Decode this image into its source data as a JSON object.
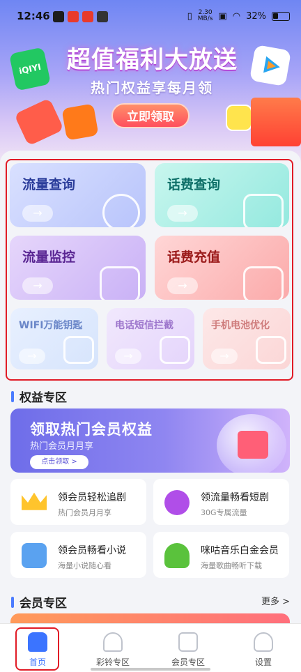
{
  "status_bar": {
    "time": "12:46",
    "net_speed": "2.30",
    "net_unit": "MB/s",
    "battery": "32%"
  },
  "banner": {
    "title": "超值福利大放送",
    "subtitle": "热门权益享每月领",
    "cta": "立即领取",
    "iqiyi_logo_text": "iQIYI"
  },
  "tools": [
    {
      "label": "流量查询",
      "arrow": "→",
      "icon": "chart-icon"
    },
    {
      "label": "话费查询",
      "arrow": "→",
      "icon": "bill-search-icon"
    },
    {
      "label": "流量监控",
      "arrow": "→",
      "icon": "transfer-icon"
    },
    {
      "label": "话费充值",
      "arrow": "→",
      "icon": "yen-phone-icon"
    },
    {
      "label": "WIFI万能钥匙",
      "arrow": "→",
      "icon": "wifi-icon"
    },
    {
      "label": "电话短信拦截",
      "arrow": "→",
      "icon": "block-call-icon"
    },
    {
      "label": "手机电池优化",
      "arrow": "→",
      "icon": "battery-icon"
    }
  ],
  "benefits_section": {
    "title": "权益专区",
    "promo": {
      "title": "领取热门会员权益",
      "subtitle": "热门会员月月享",
      "button": "点击领取 >"
    },
    "cards": [
      {
        "title": "领会员轻松追剧",
        "subtitle": "热门会员月月享",
        "icon": "crown-icon"
      },
      {
        "title": "领流量畅看短剧",
        "subtitle": "30G专属流量",
        "icon": "play-icon"
      },
      {
        "title": "领会员畅看小说",
        "subtitle": "海量小说随心看",
        "icon": "book-lamp-icon"
      },
      {
        "title": "咪咕音乐白金会员",
        "subtitle": "海量歌曲畅听下载",
        "icon": "music-note-icon"
      }
    ]
  },
  "member_section": {
    "title": "会员专区",
    "more": "更多 >"
  },
  "bottom_nav": [
    {
      "label": "首页",
      "icon": "home-icon",
      "active": true
    },
    {
      "label": "彩铃专区",
      "icon": "bell-icon",
      "active": false
    },
    {
      "label": "会员专区",
      "icon": "crown-box-icon",
      "active": false
    },
    {
      "label": "设置",
      "icon": "user-icon",
      "active": false
    }
  ]
}
